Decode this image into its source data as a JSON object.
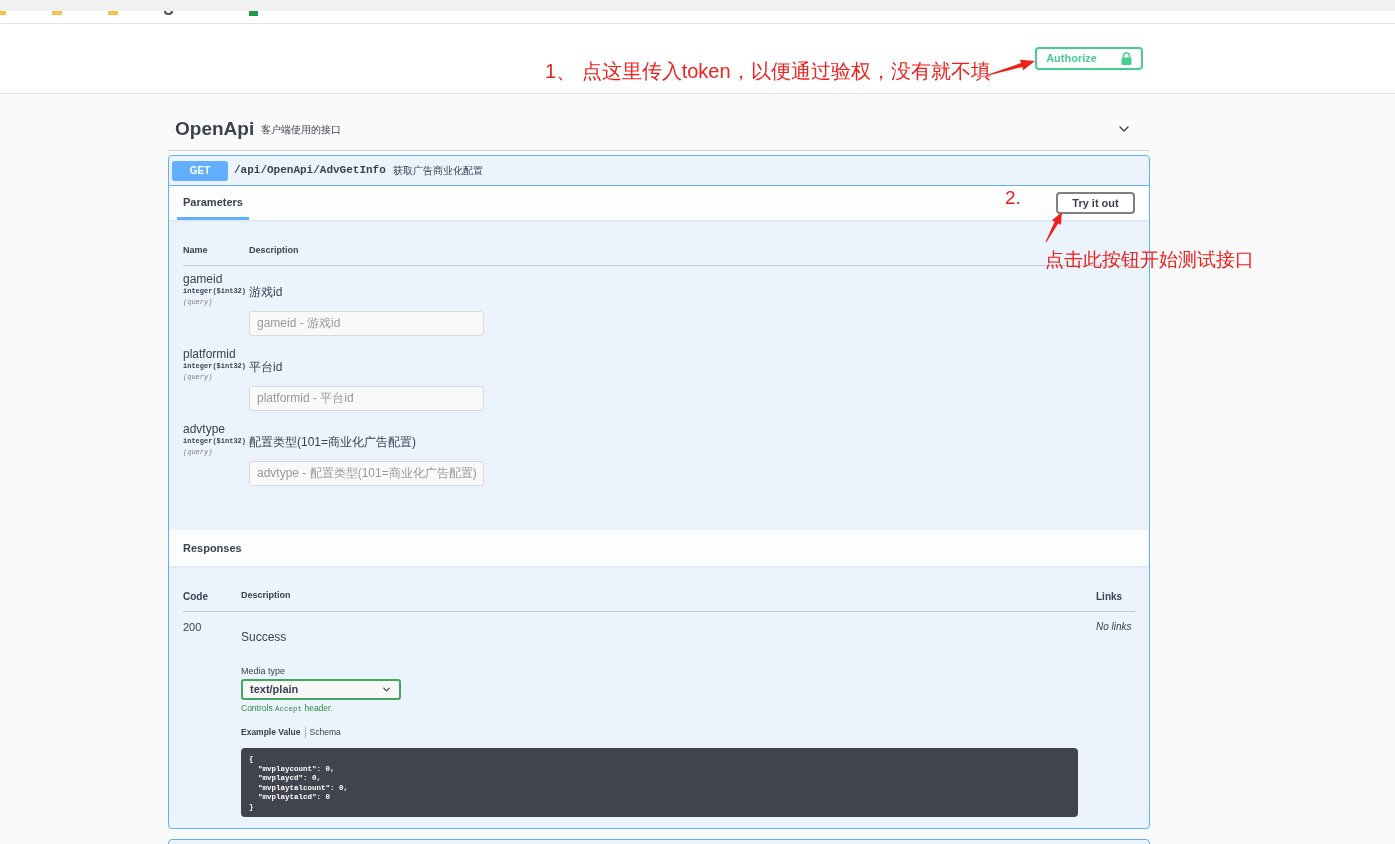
{
  "header": {
    "authorize_button": "Authorize"
  },
  "annotations": [
    {
      "kind": "step",
      "text": "1、 点这里传入token，以便通过验权，没有就不填"
    },
    {
      "kind": "step",
      "text": "2."
    },
    {
      "kind": "note",
      "text": "点击此按钮开始测试接口"
    }
  ],
  "tag": {
    "name": "OpenApi",
    "description": "客户端使用的接口",
    "expanded": true
  },
  "operation": {
    "method": "GET",
    "path": "/api/OpenApi/AdvGetInfo",
    "summary": "获取广告商业化配置",
    "tabs": [
      {
        "label": "Parameters",
        "selected": true
      }
    ],
    "try_button": "Try it out",
    "parameters": {
      "columns": [
        "Name",
        "Description"
      ],
      "rows": [
        {
          "name": "gameid",
          "type": "integer($int32)",
          "location": "(query)",
          "description": "游戏id",
          "placeholder": "gameid - 游戏id"
        },
        {
          "name": "platformid",
          "type": "integer($int32)",
          "location": "(query)",
          "description": "平台id",
          "placeholder": "platformid - 平台id"
        },
        {
          "name": "advtype",
          "type": "integer($int32)",
          "location": "(query)",
          "description": "配置类型(101=商业化广告配置)",
          "placeholder": "advtype - 配置类型(101=商业化广告配置)"
        }
      ]
    },
    "responses": {
      "title": "Responses",
      "columns": [
        "Code",
        "Description",
        "Links"
      ],
      "rows": [
        {
          "code": "200",
          "description": "Success",
          "links": "No links",
          "media_type_label": "Media type",
          "media_type": "text/plain",
          "hint": {
            "prefix": "Controls",
            "code": "Accept",
            "suffix": "header."
          },
          "example_tabs": [
            {
              "label": "Example Value",
              "selected": true
            },
            {
              "label": "Schema",
              "selected": false
            }
          ],
          "example_lines": [
            "{",
            "  \"mvplaycount\": 0,",
            "  \"mvplaycd\": 0,",
            "  \"mvplaytalcount\": 0,",
            "  \"mvplaytalcd\": 0",
            "}"
          ]
        }
      ]
    }
  }
}
